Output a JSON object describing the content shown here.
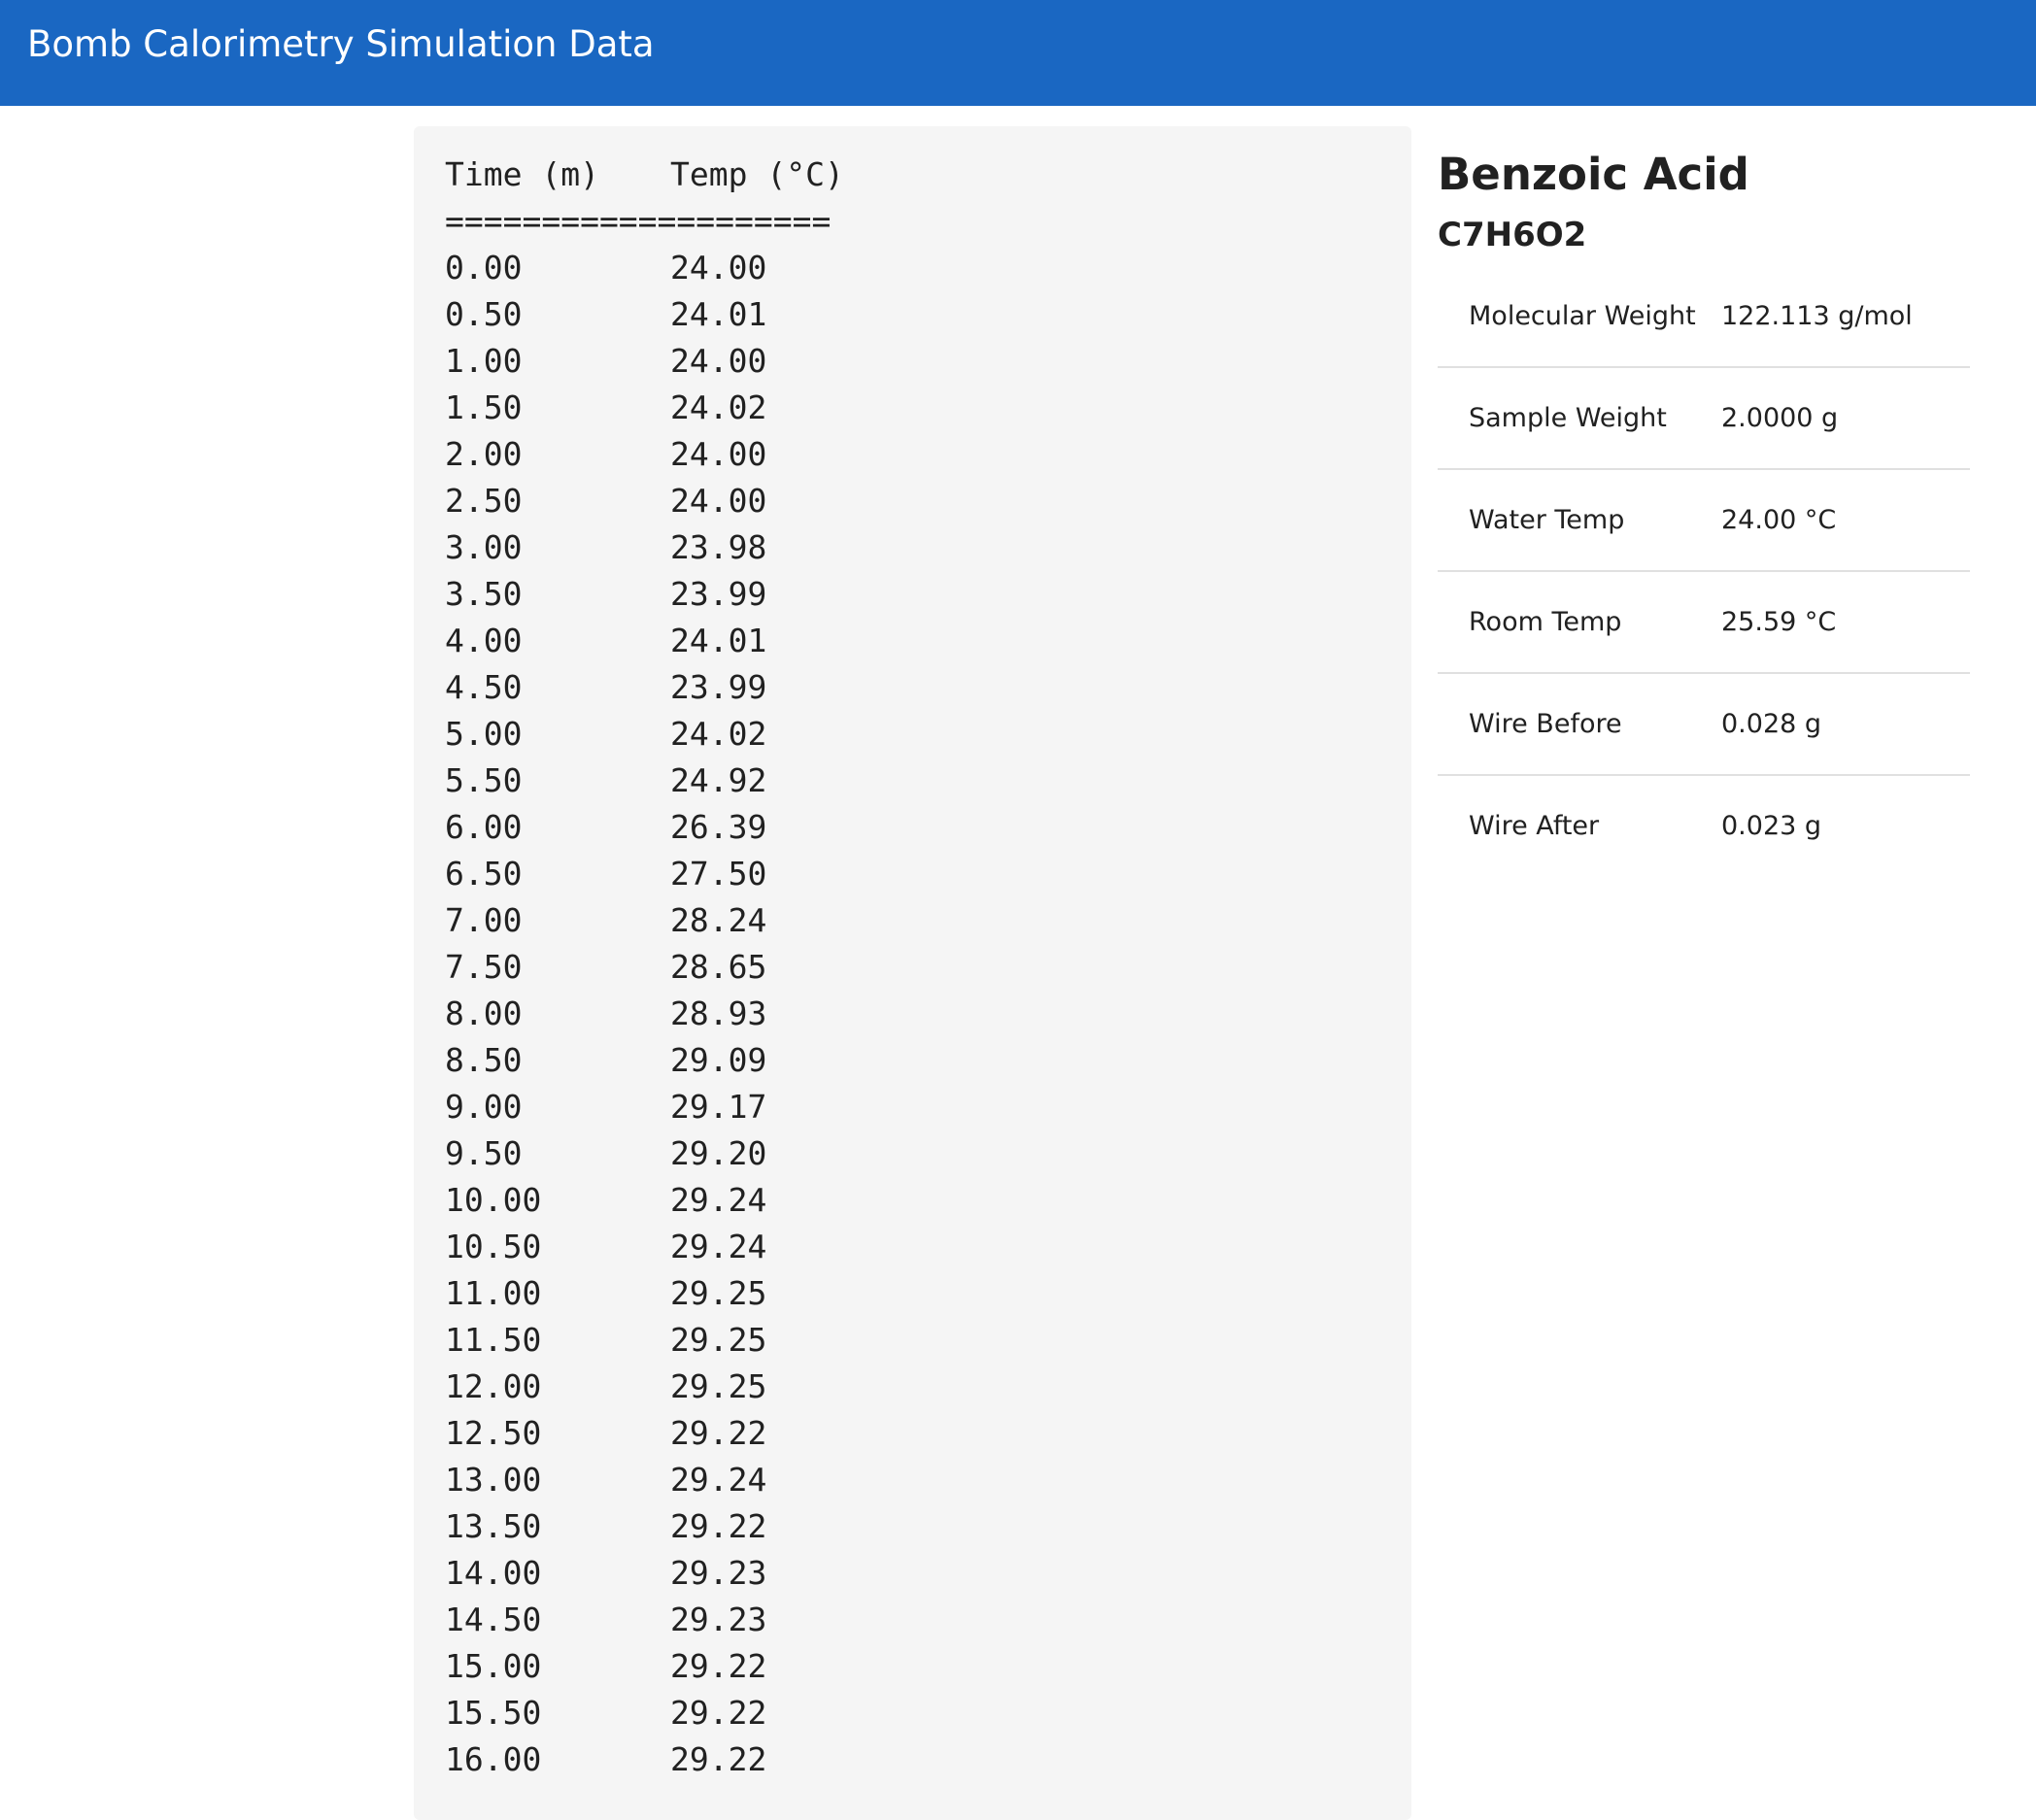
{
  "app": {
    "title": "Bomb Calorimetry Simulation Data"
  },
  "data_table": {
    "headers": {
      "time": "Time (m)",
      "temp": "Temp (°C)"
    },
    "separator": "====================",
    "rows": [
      {
        "time": "0.00",
        "temp": "24.00"
      },
      {
        "time": "0.50",
        "temp": "24.01"
      },
      {
        "time": "1.00",
        "temp": "24.00"
      },
      {
        "time": "1.50",
        "temp": "24.02"
      },
      {
        "time": "2.00",
        "temp": "24.00"
      },
      {
        "time": "2.50",
        "temp": "24.00"
      },
      {
        "time": "3.00",
        "temp": "23.98"
      },
      {
        "time": "3.50",
        "temp": "23.99"
      },
      {
        "time": "4.00",
        "temp": "24.01"
      },
      {
        "time": "4.50",
        "temp": "23.99"
      },
      {
        "time": "5.00",
        "temp": "24.02"
      },
      {
        "time": "5.50",
        "temp": "24.92"
      },
      {
        "time": "6.00",
        "temp": "26.39"
      },
      {
        "time": "6.50",
        "temp": "27.50"
      },
      {
        "time": "7.00",
        "temp": "28.24"
      },
      {
        "time": "7.50",
        "temp": "28.65"
      },
      {
        "time": "8.00",
        "temp": "28.93"
      },
      {
        "time": "8.50",
        "temp": "29.09"
      },
      {
        "time": "9.00",
        "temp": "29.17"
      },
      {
        "time": "9.50",
        "temp": "29.20"
      },
      {
        "time": "10.00",
        "temp": "29.24"
      },
      {
        "time": "10.50",
        "temp": "29.24"
      },
      {
        "time": "11.00",
        "temp": "29.25"
      },
      {
        "time": "11.50",
        "temp": "29.25"
      },
      {
        "time": "12.00",
        "temp": "29.25"
      },
      {
        "time": "12.50",
        "temp": "29.22"
      },
      {
        "time": "13.00",
        "temp": "29.24"
      },
      {
        "time": "13.50",
        "temp": "29.22"
      },
      {
        "time": "14.00",
        "temp": "29.23"
      },
      {
        "time": "14.50",
        "temp": "29.23"
      },
      {
        "time": "15.00",
        "temp": "29.22"
      },
      {
        "time": "15.50",
        "temp": "29.22"
      },
      {
        "time": "16.00",
        "temp": "29.22"
      }
    ]
  },
  "compound": {
    "name": "Benzoic Acid",
    "formula": "C7H6O2",
    "properties": [
      {
        "label": "Molecular Weight",
        "value": "122.113 g/mol"
      },
      {
        "label": "Sample Weight",
        "value": "2.0000 g"
      },
      {
        "label": "Water Temp",
        "value": "24.00 °C"
      },
      {
        "label": "Room Temp",
        "value": "25.59 °C"
      },
      {
        "label": "Wire Before",
        "value": "0.028 g"
      },
      {
        "label": "Wire After",
        "value": "0.023 g"
      }
    ]
  },
  "colors": {
    "appbar": "#1a67c2",
    "panel": "#f5f5f5",
    "divider": "#e0e0e0"
  }
}
